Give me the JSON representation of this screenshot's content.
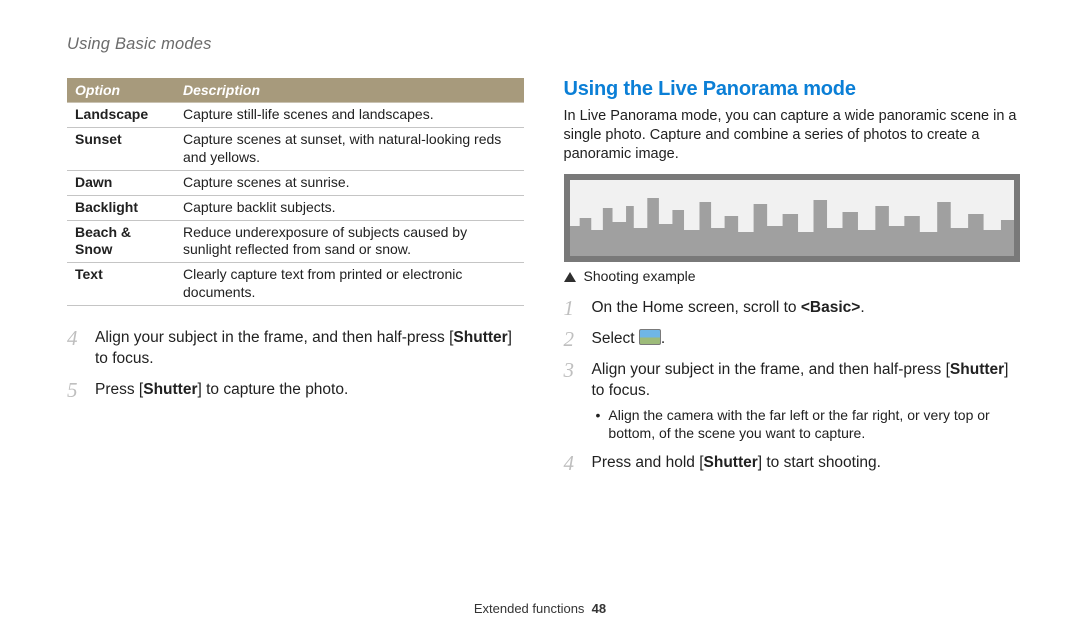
{
  "header": {
    "title": "Using Basic modes"
  },
  "leftTable": {
    "headers": {
      "option": "Option",
      "description": "Description"
    },
    "rows": [
      {
        "option": "Landscape",
        "description": "Capture still-life scenes and landscapes."
      },
      {
        "option": "Sunset",
        "description": "Capture scenes at sunset, with natural-looking reds and yellows."
      },
      {
        "option": "Dawn",
        "description": "Capture scenes at sunrise."
      },
      {
        "option": "Backlight",
        "description": "Capture backlit subjects."
      },
      {
        "option": "Beach & Snow",
        "description": "Reduce underexposure of subjects caused by sunlight reflected from sand or snow."
      },
      {
        "option": "Text",
        "description": "Clearly capture text from printed or electronic documents."
      }
    ]
  },
  "leftSteps": [
    {
      "num": "4",
      "parts": [
        "Align your subject in the frame, and then half-press [",
        {
          "b": "Shutter"
        },
        "] to focus."
      ]
    },
    {
      "num": "5",
      "parts": [
        "Press [",
        {
          "b": "Shutter"
        },
        "] to capture the photo."
      ]
    }
  ],
  "rightSection": {
    "heading": "Using the Live Panorama mode",
    "intro": "In Live Panorama mode, you can capture a wide panoramic scene in a single photo. Capture and combine a series of photos to create a panoramic image.",
    "caption": "Shooting example",
    "steps": [
      {
        "num": "1",
        "parts": [
          "On the Home screen, scroll to ",
          {
            "b": "<Basic>"
          },
          "."
        ]
      },
      {
        "num": "2",
        "parts": [
          "Select ",
          {
            "icon": "panorama-icon"
          },
          "."
        ]
      },
      {
        "num": "3",
        "parts": [
          "Align your subject in the frame, and then half-press [",
          {
            "b": "Shutter"
          },
          "] to focus."
        ],
        "bullets": [
          "Align the camera with the far left or the far right, or very top or bottom, of the scene you want to capture."
        ]
      },
      {
        "num": "4",
        "parts": [
          "Press and hold [",
          {
            "b": "Shutter"
          },
          "] to start shooting."
        ]
      }
    ]
  },
  "footer": {
    "section": "Extended functions",
    "page": "48"
  }
}
